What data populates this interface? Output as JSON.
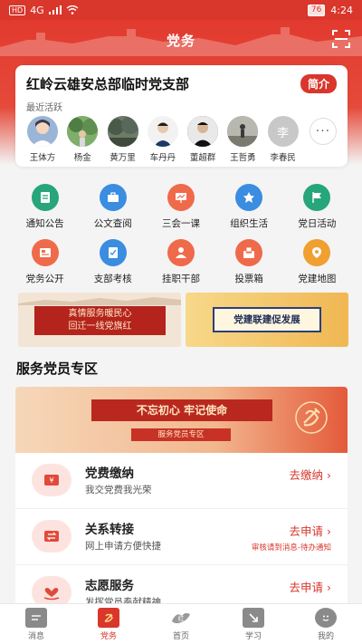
{
  "status_bar": {
    "network": "4G",
    "battery": "76",
    "time": "4:24"
  },
  "header": {
    "title": "党务",
    "scan_icon": "scan-icon"
  },
  "branch": {
    "name": "红岭云雄安总部临时党支部",
    "intro_label": "简介",
    "recent_label": "最近活跃",
    "members": [
      {
        "name": "王体方",
        "color": "#9bb5d6"
      },
      {
        "name": "杨金",
        "color": "#6f9a5a"
      },
      {
        "name": "黄万里",
        "color": "#5c6c5a"
      },
      {
        "name": "车丹丹",
        "color": "#ffffff"
      },
      {
        "name": "董超群",
        "color": "#2d2d2d"
      },
      {
        "name": "王哲勇",
        "color": "#8a8a8a"
      },
      {
        "name": "李春民",
        "color": "#c8c8c8",
        "initial": "李"
      }
    ],
    "more_label": "···"
  },
  "features": [
    {
      "label": "通知公告",
      "icon": "notice-icon",
      "color": "#27a57b"
    },
    {
      "label": "公文查阅",
      "icon": "briefcase-icon",
      "color": "#3a8de0"
    },
    {
      "label": "三会一课",
      "icon": "presentation-icon",
      "color": "#ef6a4a"
    },
    {
      "label": "组织生活",
      "icon": "organization-icon",
      "color": "#3a8de0"
    },
    {
      "label": "党日活动",
      "icon": "flag-icon",
      "color": "#27a57b"
    },
    {
      "label": "党务公开",
      "icon": "bulletin-icon",
      "color": "#ef6a4a"
    },
    {
      "label": "支部考核",
      "icon": "assessment-icon",
      "color": "#3a8de0"
    },
    {
      "label": "挂职干部",
      "icon": "cadre-icon",
      "color": "#ef6a4a"
    },
    {
      "label": "投票箱",
      "icon": "ballot-box-icon",
      "color": "#ef6a4a"
    },
    {
      "label": "党建地图",
      "icon": "map-pin-icon",
      "color": "#f0a030"
    }
  ],
  "banners": {
    "left": {
      "line1": "真情服务暖民心",
      "line2": "回迁一线党旗红"
    },
    "right": {
      "text": "党建联建促发展"
    }
  },
  "section": {
    "title": "服务党员专区",
    "banner_motto": "不忘初心 牢记使命",
    "banner_zone": "服务党员专区"
  },
  "services": [
    {
      "title": "党费缴纳",
      "desc": "我交党费我光荣",
      "action": "去缴纳 ›",
      "note": "",
      "icon": "wallet-icon"
    },
    {
      "title": "关系转接",
      "desc": "网上申请方便快捷",
      "action": "去申请 ›",
      "note": "审核请到消息-待办通知",
      "icon": "transfer-icon"
    },
    {
      "title": "志愿服务",
      "desc": "发挥党员奉献精神",
      "action": "去申请 ›",
      "note": "",
      "icon": "heart-hand-icon"
    }
  ],
  "bottom_nav": [
    {
      "label": "消息",
      "icon": "message-icon",
      "active": false
    },
    {
      "label": "党务",
      "icon": "party-icon",
      "active": true
    },
    {
      "label": "首页",
      "icon": "home-icon",
      "active": false
    },
    {
      "label": "学习",
      "icon": "study-icon",
      "active": false
    },
    {
      "label": "我的",
      "icon": "profile-icon",
      "active": false
    }
  ],
  "colors": {
    "primary": "#d9362c",
    "background": "#f4f4f4"
  }
}
